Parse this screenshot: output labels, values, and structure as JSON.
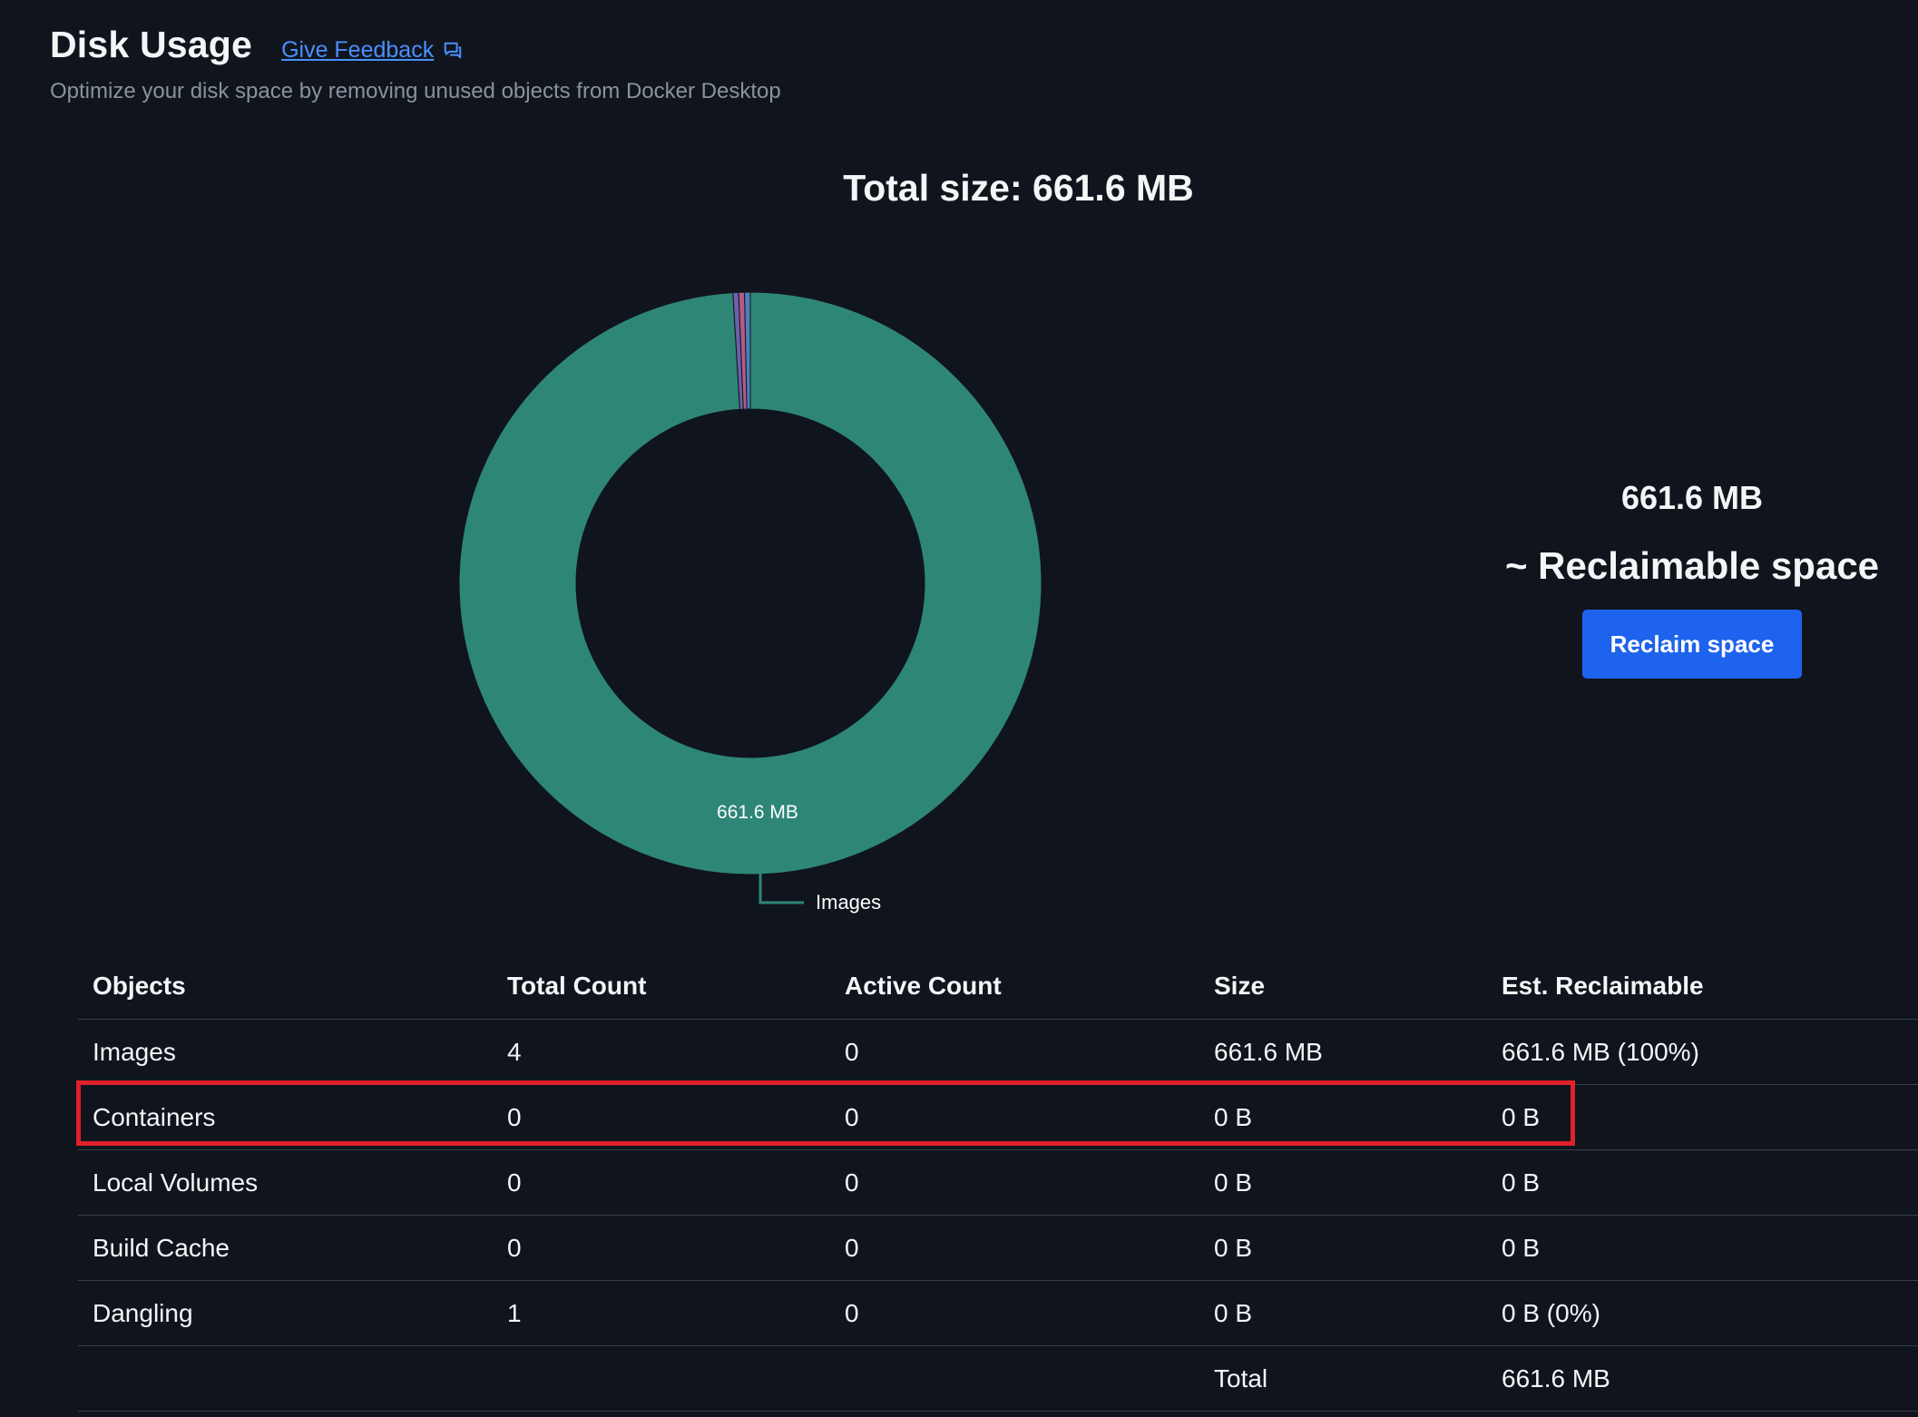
{
  "header": {
    "title": "Disk Usage",
    "feedback_label": "Give Feedback",
    "feedback_icon": "feedback-chat-icon",
    "subtitle": "Optimize your disk space by removing unused objects from Docker Desktop"
  },
  "total_size_label": "Total size: 661.6 MB",
  "chart_data": {
    "type": "pie",
    "style": "donut",
    "categories": [
      "Images",
      "Containers",
      "Local Volumes",
      "Build Cache",
      "Dangling"
    ],
    "values": [
      661.6,
      0,
      0,
      0,
      0
    ],
    "unit": "MB",
    "data_labels": [
      "661.6 MB"
    ],
    "callout_label": "Images",
    "colors": {
      "Images": "#2e8677",
      "slivers": [
        "#6b5fa8",
        "#b55a8a",
        "#4d7fb8"
      ]
    }
  },
  "reclaim": {
    "amount": "661.6 MB",
    "label": "~ Reclaimable space",
    "button_label": "Reclaim space"
  },
  "table": {
    "headers": [
      "Objects",
      "Total Count",
      "Active Count",
      "Size",
      "Est. Reclaimable"
    ],
    "rows": [
      [
        "Images",
        "4",
        "0",
        "661.6 MB",
        "661.6 MB (100%)"
      ],
      [
        "Containers",
        "0",
        "0",
        "0 B",
        "0 B"
      ],
      [
        "Local Volumes",
        "0",
        "0",
        "0 B",
        "0 B"
      ],
      [
        "Build Cache",
        "0",
        "0",
        "0 B",
        "0 B"
      ],
      [
        "Dangling",
        "1",
        "0",
        "0 B",
        "0 B (0%)"
      ]
    ],
    "footer": [
      "",
      "",
      "",
      "Total",
      "661.6 MB"
    ]
  },
  "colors": {
    "background": "#10151d",
    "accent": "#1d63ed",
    "link": "#4a8fff",
    "highlight": "#e0202a"
  }
}
